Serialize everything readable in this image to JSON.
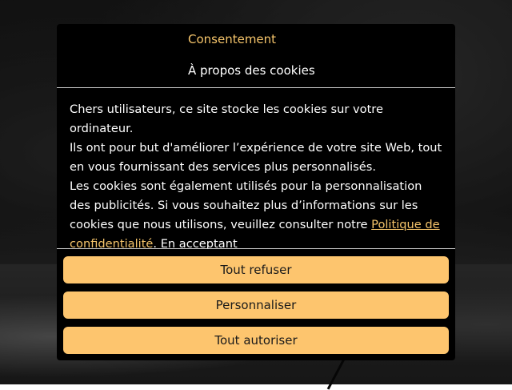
{
  "dialog": {
    "tabs": {
      "consent": "Consentement",
      "about": "À propos des cookies"
    },
    "body": {
      "line1": "Chers utilisateurs, ce site stocke les cookies sur votre ordinateur.",
      "line2": "Ils ont pour but d'améliorer l’expérience de votre site Web, tout en vous fournissant des services plus personnalisés.",
      "line3": "Les cookies sont également utilisés pour la personnalisation des publicités. Si vous souhaitez plus d’informations sur les cookies que nous utilisons, veuillez consulter notre",
      "link": "Politique de confidentialité",
      "after_link": ". En acceptant"
    },
    "buttons": {
      "refuse": "Tout refuser",
      "customize": "Personnaliser",
      "allow": "Tout autoriser"
    }
  },
  "colors": {
    "accent": "#f6c56b",
    "button": "#fdc56e",
    "dialog_bg": "#000000"
  }
}
